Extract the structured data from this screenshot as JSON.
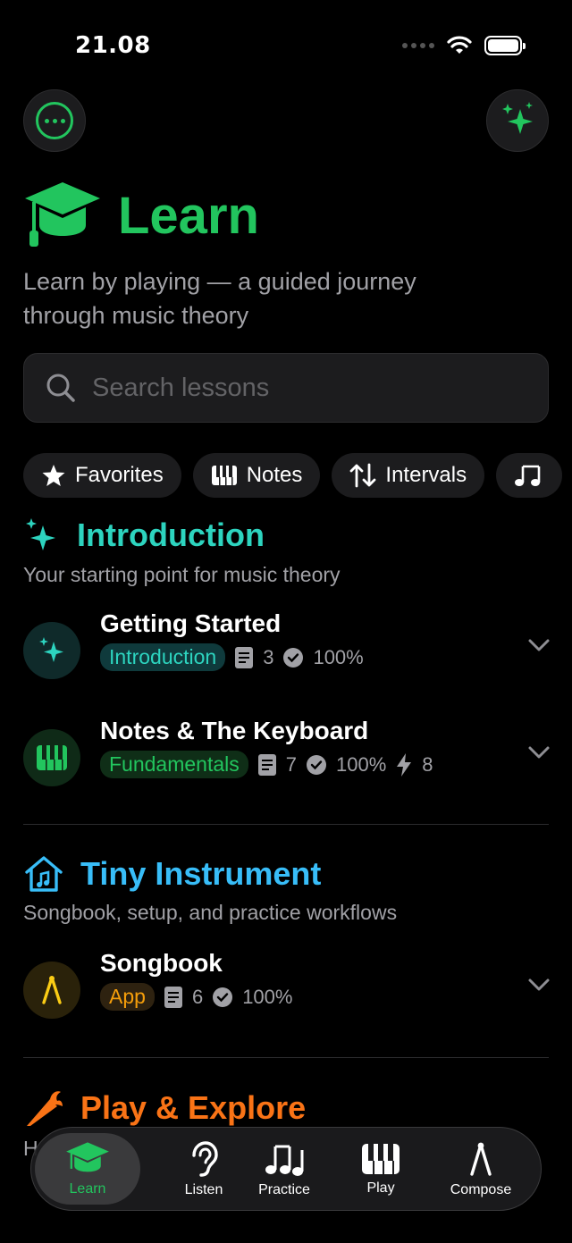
{
  "status": {
    "time": "21.08"
  },
  "header": {
    "title": "Learn",
    "subtitle_line1": "Learn by playing — a guided journey",
    "subtitle_line2": "through music theory"
  },
  "search": {
    "placeholder": "Search lessons"
  },
  "chips": [
    {
      "label": "Favorites",
      "icon": "star-icon"
    },
    {
      "label": "Notes",
      "icon": "piano-keys-icon"
    },
    {
      "label": "Intervals",
      "icon": "arrows-up-down-icon"
    },
    {
      "label": "",
      "icon": "music-notes-icon"
    }
  ],
  "sections": {
    "introduction": {
      "title": "Introduction",
      "subtitle": "Your starting point for music theory",
      "color": "#2dd4bf",
      "lessons": [
        {
          "title": "Getting Started",
          "tag": "Introduction",
          "pages": "3",
          "progress": "100%"
        },
        {
          "title": "Notes & The Keyboard",
          "tag": "Fundamentals",
          "pages": "7",
          "progress": "100%",
          "xp": "8"
        }
      ]
    },
    "tiny_instrument": {
      "title": "Tiny Instrument",
      "subtitle": "Songbook, setup, and practice workflows",
      "color": "#38bdf8",
      "lessons": [
        {
          "title": "Songbook",
          "tag": "App",
          "pages": "6",
          "progress": "100%"
        }
      ]
    },
    "play_explore": {
      "title": "Play & Explore",
      "subtitle_partial": "H",
      "color": "#f97316"
    }
  },
  "tabbar": {
    "items": [
      {
        "label": "Learn",
        "icon": "graduation-cap-icon",
        "active": true
      },
      {
        "label": "Listen",
        "icon": "ear-icon",
        "active": false
      },
      {
        "label": "Practice",
        "icon": "music-notes-icon",
        "active": false
      },
      {
        "label": "Play",
        "icon": "piano-keys-icon",
        "active": false
      },
      {
        "label": "Compose",
        "icon": "compass-icon",
        "active": false
      }
    ]
  },
  "colors": {
    "accent": "#22c55e",
    "teal": "#2dd4bf",
    "sky": "#38bdf8",
    "orange": "#f97316",
    "yellow": "#facc15"
  }
}
